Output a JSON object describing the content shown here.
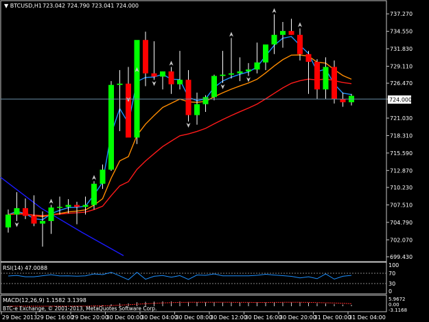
{
  "header": {
    "symbol": "BTCUSD,H1",
    "ohlc": "723.042 724.790 723.041 724.000"
  },
  "rsi": {
    "label": "RSI(14) 47.0088",
    "levels": [
      "100",
      "70",
      "30",
      "0"
    ]
  },
  "macd": {
    "label": "MACD(12,26,9) 1.1582 3.1398",
    "values": [
      "5.9672",
      "0.00",
      "-3.1168"
    ]
  },
  "copyright": "BTC-e Exchange, © 2001-2013, MetaQuotes Software Corp.",
  "current_price_label": "724.000",
  "colors": {
    "bull": "#00ff00",
    "bear": "#ff0000",
    "ma_fast": "#1e90ff",
    "ma_mid": "#ff8c00",
    "ma_slow": "#ff1a1a",
    "ma_long": "#1a1aff",
    "grid": "#4a4a4a",
    "price_line": "#6a8da8"
  },
  "chart_data": {
    "type": "candlestick",
    "y_ticks": [
      "737.270",
      "734.550",
      "731.830",
      "729.110",
      "726.470",
      "724.000",
      "721.030",
      "718.310",
      "715.590",
      "712.870",
      "710.230",
      "707.510",
      "704.790",
      "702.070",
      "699.430"
    ],
    "x_ticks": [
      "29 Dec 2013",
      "29 Dec 16:00",
      "29 Dec 20:00",
      "30 Dec 00:00",
      "30 Dec 04:00",
      "30 Dec 08:00",
      "30 Dec 12:00",
      "30 Dec 16:00",
      "30 Dec 20:00",
      "31 Dec 00:00",
      "31 Dec 04:00"
    ],
    "ylim": [
      699.0,
      739.0
    ],
    "candles": [
      [
        704.0,
        706.8,
        703.2,
        706.0
      ],
      [
        706.0,
        709.5,
        705.0,
        707.0
      ],
      [
        707.0,
        708.5,
        705.3,
        705.8
      ],
      [
        705.8,
        709.0,
        704.2,
        704.6
      ],
      [
        704.6,
        706.5,
        701.0,
        705.0
      ],
      [
        705.0,
        707.5,
        703.0,
        707.1
      ],
      [
        707.1,
        708.8,
        706.0,
        707.2
      ],
      [
        707.2,
        708.4,
        706.2,
        707.5
      ],
      [
        707.5,
        708.0,
        704.5,
        707.2
      ],
      [
        707.2,
        708.8,
        706.0,
        707.5
      ],
      [
        707.5,
        711.2,
        706.8,
        710.8
      ],
      [
        710.8,
        713.8,
        710.0,
        713.0
      ],
      [
        713.0,
        726.8,
        712.8,
        726.2
      ],
      [
        726.2,
        728.5,
        719.0,
        726.4
      ],
      [
        726.4,
        729.0,
        724.5,
        718.0
      ],
      [
        718.0,
        728.0,
        717.0,
        733.2
      ],
      [
        733.2,
        734.5,
        726.0,
        728.0
      ],
      [
        728.0,
        733.0,
        727.0,
        727.5
      ],
      [
        727.5,
        728.3,
        725.5,
        728.3
      ],
      [
        728.3,
        729.0,
        724.8,
        726.3
      ],
      [
        726.3,
        731.5,
        725.5,
        727.0
      ],
      [
        727.0,
        728.5,
        720.5,
        721.5
      ],
      [
        721.5,
        725.0,
        720.0,
        723.2
      ],
      [
        723.2,
        724.6,
        722.0,
        724.3
      ],
      [
        724.3,
        727.8,
        723.8,
        727.6
      ],
      [
        727.6,
        731.5,
        726.5,
        727.8
      ],
      [
        727.8,
        733.5,
        727.2,
        728.0
      ],
      [
        728.0,
        730.5,
        726.8,
        728.3
      ],
      [
        728.3,
        729.6,
        727.6,
        728.6
      ],
      [
        728.6,
        732.8,
        728.0,
        729.7
      ],
      [
        729.7,
        731.5,
        728.5,
        732.5
      ],
      [
        732.5,
        737.2,
        731.0,
        734.0
      ],
      [
        734.0,
        736.0,
        732.0,
        734.6
      ],
      [
        734.6,
        736.5,
        734.0,
        734.0
      ],
      [
        734.0,
        735.0,
        730.0,
        731.0
      ],
      [
        731.0,
        731.5,
        724.8,
        729.8
      ],
      [
        729.8,
        730.2,
        724.0,
        725.5
      ],
      [
        725.5,
        730.5,
        724.0,
        729.0
      ],
      [
        729.0,
        730.0,
        723.3,
        724.0
      ],
      [
        724.0,
        725.0,
        722.8,
        723.5
      ],
      [
        723.5,
        724.8,
        723.0,
        724.5
      ]
    ]
  }
}
